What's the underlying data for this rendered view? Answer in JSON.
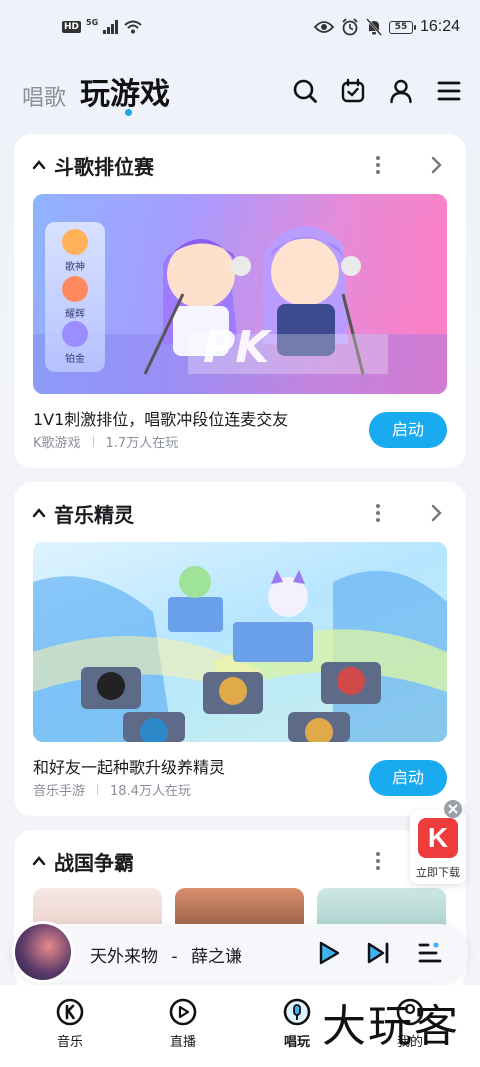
{
  "status_bar": {
    "hd": "HD",
    "network": "5G",
    "battery": "55",
    "time": "16:24"
  },
  "header": {
    "tab_sing": "唱歌",
    "tab_game": "玩游戏"
  },
  "cards": [
    {
      "title": "斗歌排位赛",
      "banner_badges": [
        "歌神",
        "耀辉",
        "铂金"
      ],
      "banner_text": "PK",
      "desc": "1V1刺激排位，唱歌冲段位连麦交友",
      "category": "K歌游戏",
      "players": "1.7万人在玩",
      "button": "启动"
    },
    {
      "title": "音乐精灵",
      "desc": "和好友一起种歌升级养精灵",
      "category": "音乐手游",
      "players": "18.4万人在玩",
      "button": "启动"
    },
    {
      "title": "战国争霸"
    }
  ],
  "download_widget": {
    "logo_letter": "K",
    "label": "立即下载"
  },
  "player": {
    "song": "天外来物",
    "separator": "-",
    "artist": "薛之谦"
  },
  "bottom_nav": [
    {
      "label": "音乐",
      "icon": "k-music-icon"
    },
    {
      "label": "直播",
      "icon": "live-play-icon"
    },
    {
      "label": "唱玩",
      "icon": "mic-icon",
      "active": true
    },
    {
      "label": "我的",
      "icon": "profile-icon"
    }
  ],
  "watermark": "大玩客",
  "colors": {
    "accent": "#19aaf0",
    "title": "#1b1b1f",
    "muted": "#8a8f99"
  }
}
